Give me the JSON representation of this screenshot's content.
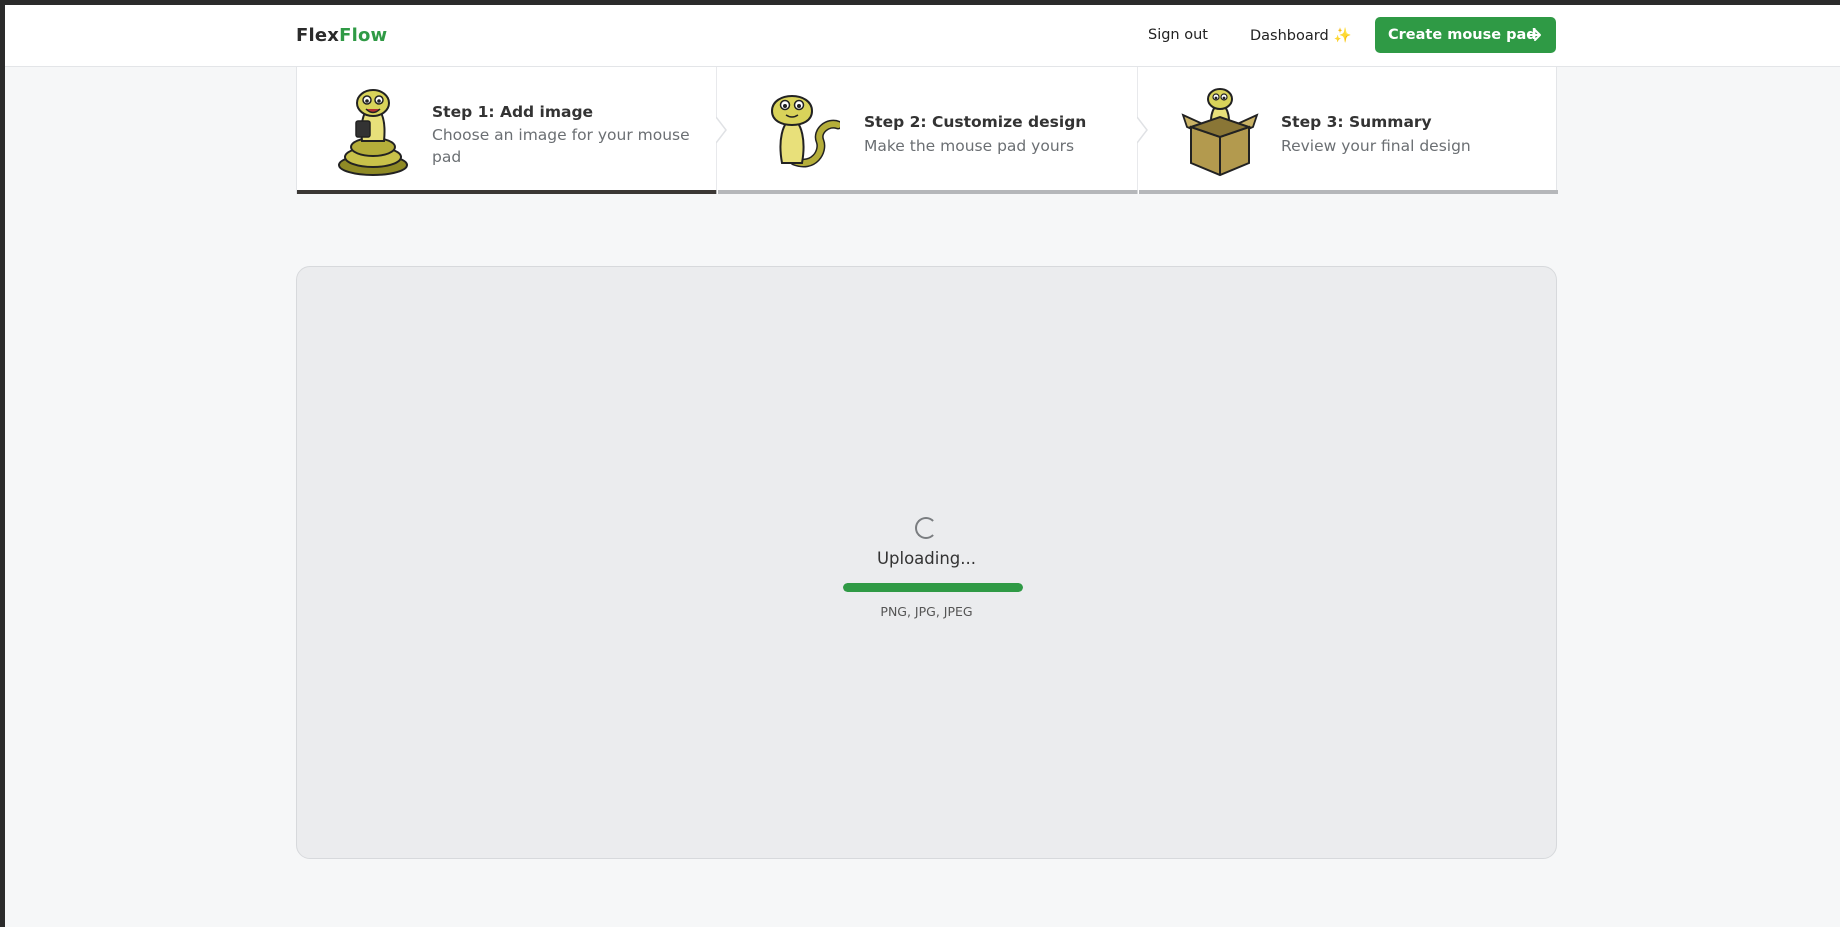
{
  "header": {
    "logo_part1": "Flex",
    "logo_part2": "Flow",
    "signout_label": "Sign out",
    "dashboard_label": "Dashboard",
    "dashboard_icon": "sparkle-icon",
    "cta_label": "Create mouse pad",
    "cta_icon": "arrow-right-icon",
    "brand_color": "#2f9a45"
  },
  "steps": [
    {
      "title": "Step 1: Add image",
      "desc_line1": "Choose an image for your mouse",
      "desc_line2": "pad",
      "active": true,
      "icon": "snake-mascot-icon"
    },
    {
      "title": "Step 2: Customize design",
      "desc_line1": "Make the mouse pad yours",
      "desc_line2": "",
      "active": false,
      "icon": "snake-mascot-icon"
    },
    {
      "title": "Step 3: Summary",
      "desc_line1": "Review your final design",
      "desc_line2": "",
      "active": false,
      "icon": "snake-in-box-icon"
    }
  ],
  "upload": {
    "status": "Uploading...",
    "formats": "PNG, JPG, JPEG",
    "progress": 1.0,
    "spinner_icon": "spinner-icon"
  }
}
